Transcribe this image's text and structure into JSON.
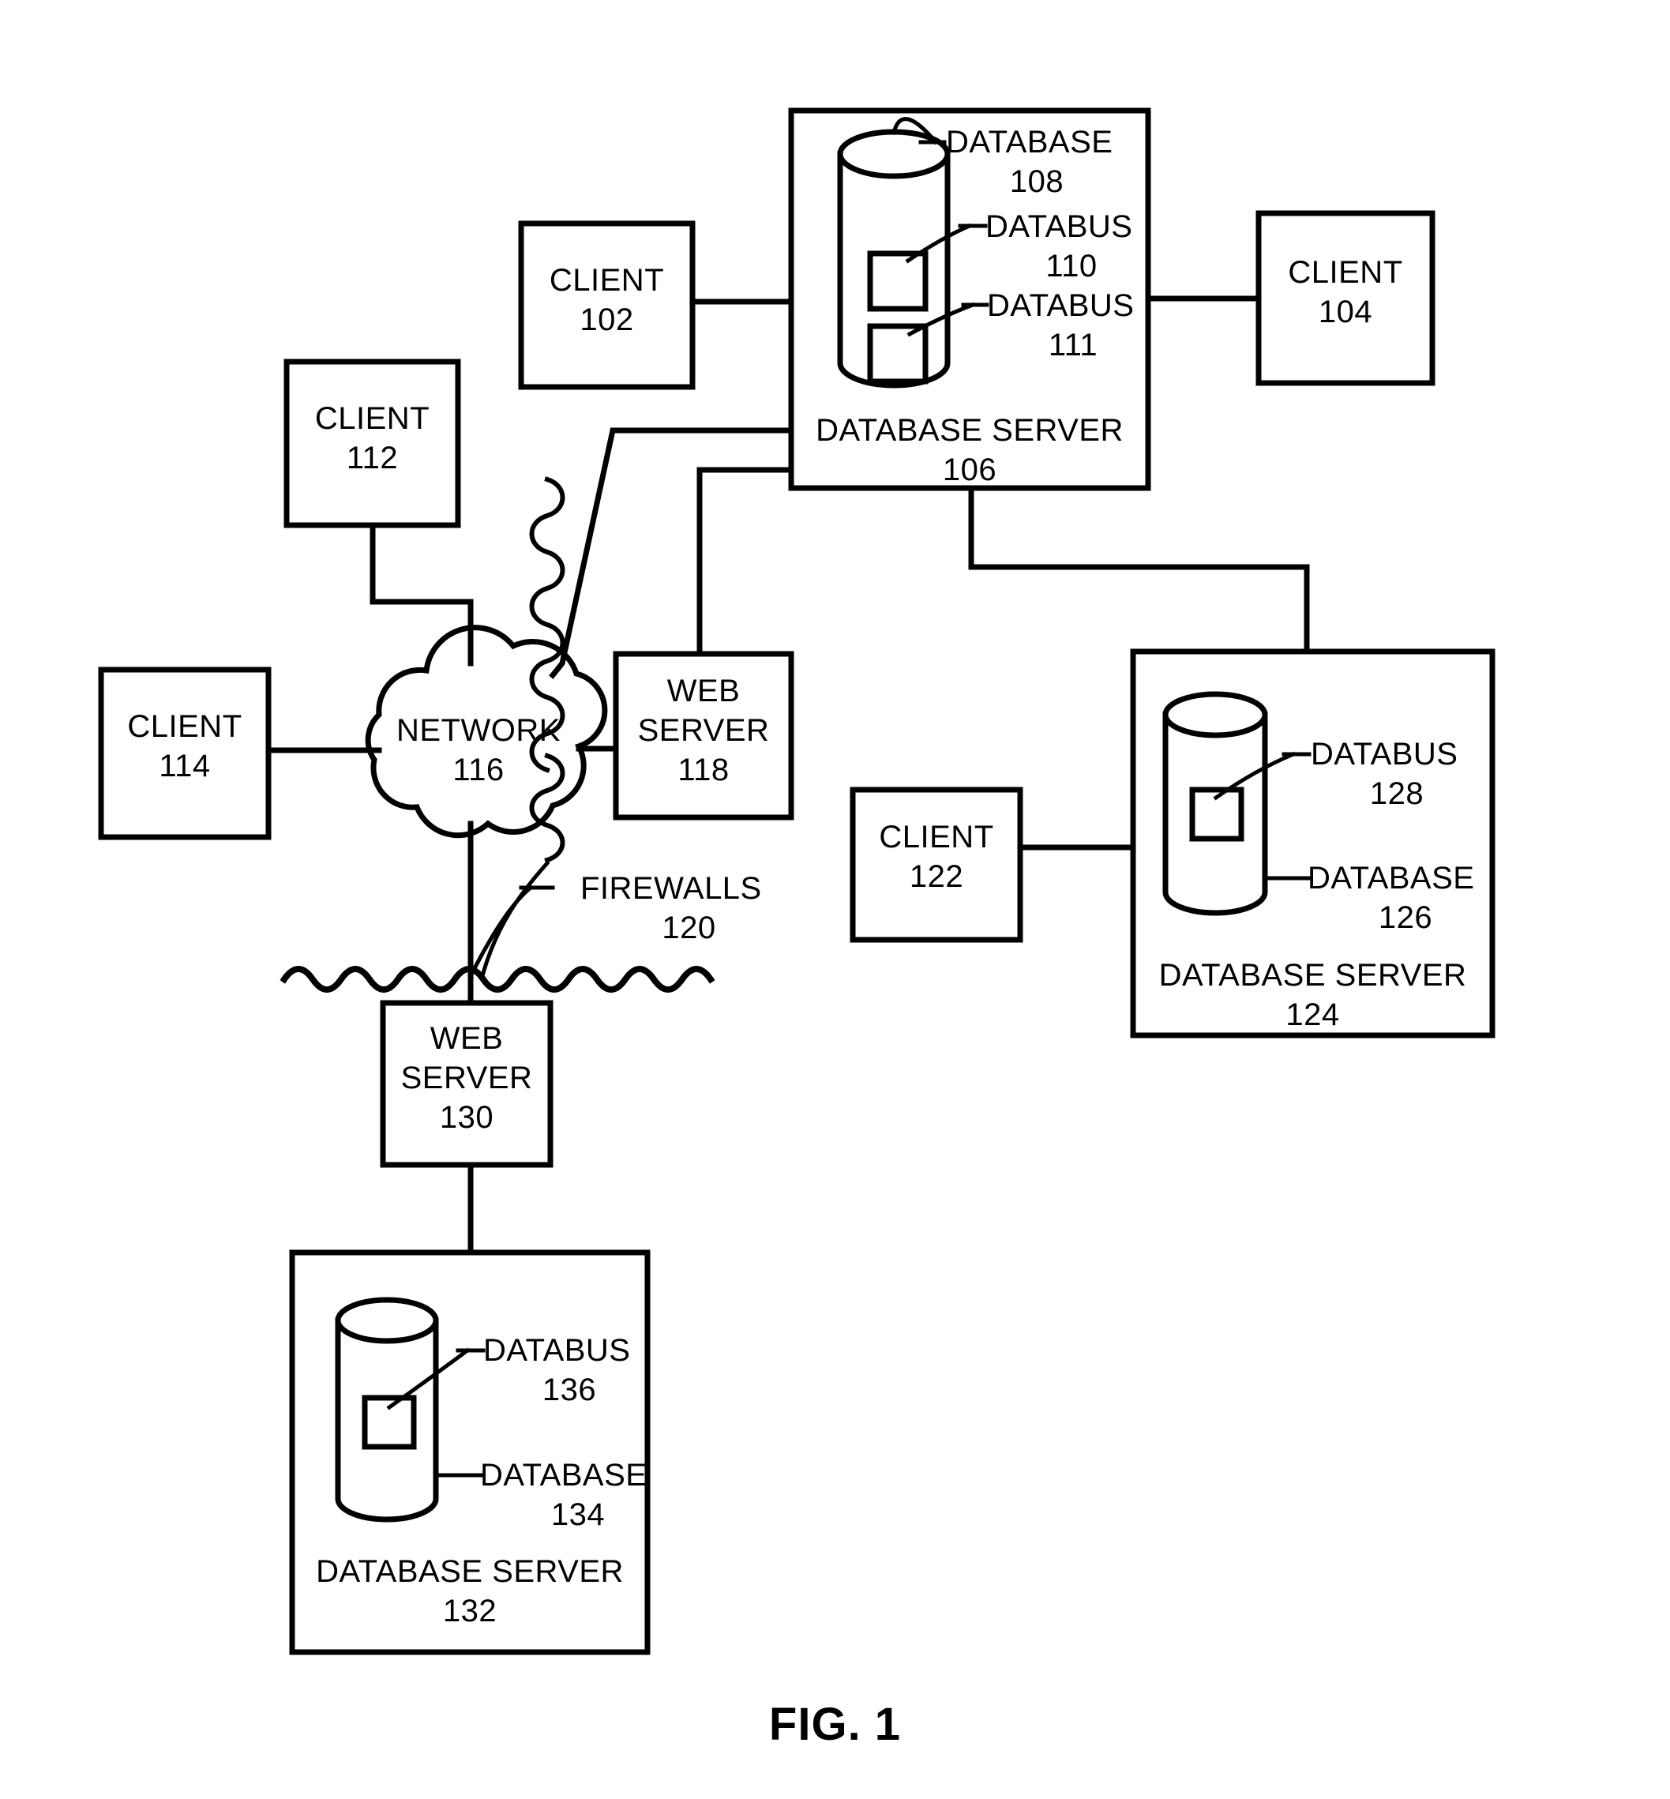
{
  "figure": {
    "caption": "FIG. 1"
  },
  "nodes": {
    "client_102": {
      "type": "CLIENT",
      "label": "CLIENT",
      "ref": "102"
    },
    "client_104": {
      "type": "CLIENT",
      "label": "CLIENT",
      "ref": "104"
    },
    "client_112": {
      "type": "CLIENT",
      "label": "CLIENT",
      "ref": "112"
    },
    "client_114": {
      "type": "CLIENT",
      "label": "CLIENT",
      "ref": "114"
    },
    "client_122": {
      "type": "CLIENT",
      "label": "CLIENT",
      "ref": "122"
    },
    "database_server_106": {
      "type": "DATABASE SERVER",
      "label": "DATABASE SERVER",
      "ref": "106"
    },
    "database_108": {
      "type": "DATABASE",
      "label": "DATABASE",
      "ref": "108"
    },
    "databus_110": {
      "type": "DATABUS",
      "label": "DATABUS",
      "ref": "110"
    },
    "databus_111": {
      "type": "DATABUS",
      "label": "DATABUS",
      "ref": "111"
    },
    "network_116": {
      "type": "NETWORK",
      "label": "NETWORK",
      "ref": "116"
    },
    "web_server_118": {
      "type": "WEB SERVER",
      "label_line1": "WEB",
      "label_line2": "SERVER",
      "ref": "118"
    },
    "firewalls_120": {
      "type": "FIREWALLS",
      "label": "FIREWALLS",
      "ref": "120"
    },
    "database_server_124": {
      "type": "DATABASE SERVER",
      "label": "DATABASE SERVER",
      "ref": "124"
    },
    "database_126": {
      "type": "DATABASE",
      "label": "DATABASE",
      "ref": "126"
    },
    "databus_128": {
      "type": "DATABUS",
      "label": "DATABUS",
      "ref": "128"
    },
    "web_server_130": {
      "type": "WEB SERVER",
      "label_line1": "WEB",
      "label_line2": "SERVER",
      "ref": "130"
    },
    "database_server_132": {
      "type": "DATABASE SERVER",
      "label": "DATABASE SERVER",
      "ref": "132"
    },
    "database_134": {
      "type": "DATABASE",
      "label": "DATABASE",
      "ref": "134"
    },
    "databus_136": {
      "type": "DATABUS",
      "label": "DATABUS",
      "ref": "136"
    }
  },
  "style": {
    "line_color": "#000000",
    "background": "#ffffff"
  }
}
